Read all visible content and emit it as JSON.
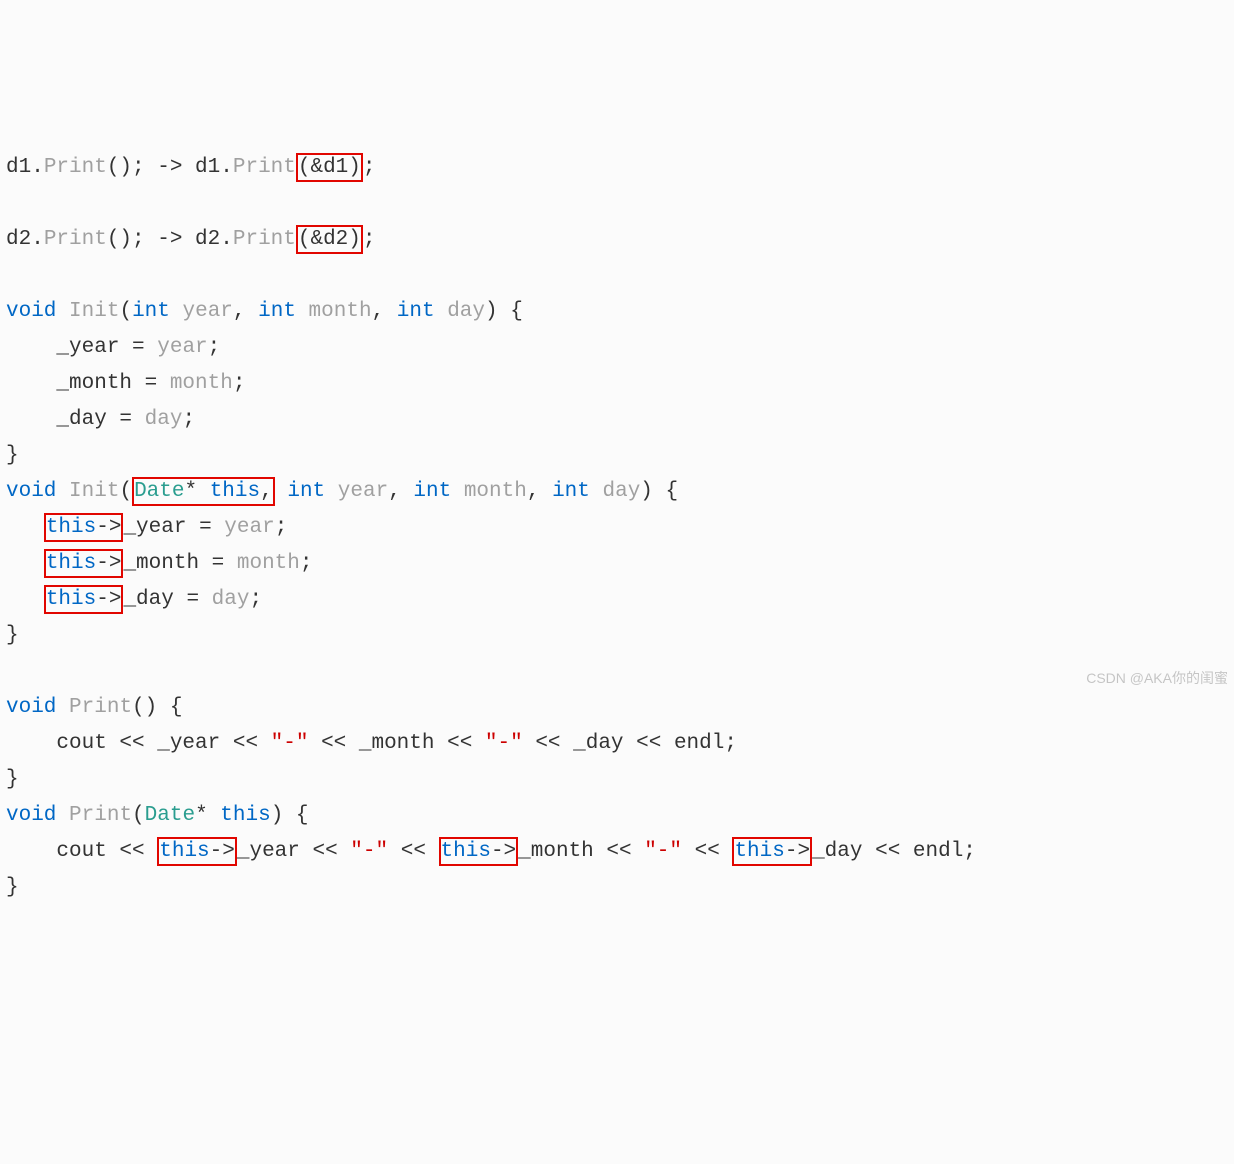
{
  "line1": {
    "a": "d1.",
    "b": "Print",
    "c": "(); -> d1.",
    "d": "Print",
    "boxed": "(&d1)",
    "e": ";"
  },
  "line2": {
    "a": "d2.",
    "b": "Print",
    "c": "(); -> d2.",
    "d": "Print",
    "boxed": "(&d2)",
    "e": ";"
  },
  "init1": {
    "kw_void": "void",
    "sp1": " ",
    "fn": "Init",
    "open": "(",
    "kw_int1": "int",
    "sp2": " ",
    "p_year": "year",
    "c1": ", ",
    "kw_int2": "int",
    "sp3": " ",
    "p_month": "month",
    "c2": ", ",
    "kw_int3": "int",
    "sp4": " ",
    "p_day": "day",
    "close": ") {",
    "b1_a": "    _year = ",
    "b1_b": "year",
    "b1_c": ";",
    "b2_a": "    _month = ",
    "b2_b": "month",
    "b2_c": ";",
    "b3_a": "    _day = ",
    "b3_b": "day",
    "b3_c": ";",
    "end": "}"
  },
  "init2": {
    "kw_void": "void",
    "sp1": " ",
    "fn": "Init",
    "open": "(",
    "box_type": "Date",
    "box_ptr": "* ",
    "box_this": "this",
    "box_comma": ",",
    "sp_after": " ",
    "kw_int1": "int",
    "sp2": " ",
    "p_year": "year",
    "c1": ", ",
    "kw_int2": "int",
    "sp3": " ",
    "p_month": "month",
    "c2": ", ",
    "kw_int3": "int",
    "sp4": " ",
    "p_day": "day",
    "close": ") {",
    "ind": "   ",
    "bx1_this": "this",
    "bx1_arr": "->",
    "b1_a": "_year = ",
    "b1_b": "year",
    "b1_c": ";",
    "bx2_this": "this",
    "bx2_arr": "->",
    "b2_a": "_month = ",
    "b2_b": "month",
    "b2_c": ";",
    "bx3_this": "this",
    "bx3_arr": "->",
    "b3_a": "_day = ",
    "b3_b": "day",
    "b3_c": ";",
    "end": "}"
  },
  "print1": {
    "kw_void": "void",
    "sp1": " ",
    "fn": "Print",
    "sig": "() {",
    "ind": "    cout << _year << ",
    "s1": "\"-\"",
    "m1": " << _month << ",
    "s2": "\"-\"",
    "m2": " << _day << endl;",
    "end": "}"
  },
  "print2": {
    "kw_void": "void",
    "sp1": " ",
    "fn": "Print",
    "open": "(",
    "type": "Date",
    "ptr": "* ",
    "this": "this",
    "close": ") {",
    "ind": "    cout << ",
    "bx1_this": "this",
    "bx1_arr": "->",
    "m_year": "_year << ",
    "s1": "\"-\"",
    "mid1": " << ",
    "bx2_this": "this",
    "bx2_arr": "->",
    "m_month": "_month << ",
    "s2": "\"-\"",
    "mid2": " << ",
    "bx3_this": "this",
    "bx3_arr": "->",
    "m_day": "_day << endl;",
    "end": "}"
  },
  "watermark": "CSDN @AKA你的闺蜜"
}
